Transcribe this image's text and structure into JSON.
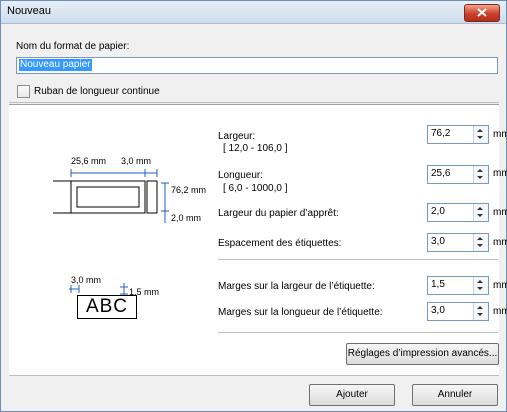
{
  "window": {
    "title": "Nouveau"
  },
  "form": {
    "name_label": "Nom du format de papier:",
    "name_value": "Nouveau papier",
    "continuous_label": "Ruban de longueur continue"
  },
  "diagram": {
    "label_width_dim": "25,6 mm",
    "right_margin_dim": "3,0 mm",
    "height_dim": "76,2 mm",
    "gap_dim": "2,0 mm",
    "margin_top_dim": "3,0 mm",
    "margin_right_dim": "1,5 mm",
    "abc_text": "ABC"
  },
  "fields": {
    "largeur": {
      "label": "Largeur:",
      "range": "[ 12,0 - 106,0 ]",
      "value": "76,2",
      "unit": "mm"
    },
    "longueur": {
      "label": "Longueur:",
      "range": "[ 6,0 - 1000,0 ]",
      "value": "25,6",
      "unit": "mm"
    },
    "largeur_appret": {
      "label": "Largeur du papier d’apprêt:",
      "value": "2,0",
      "unit": "mm"
    },
    "espacement": {
      "label": "Espacement des étiquettes:",
      "value": "3,0",
      "unit": "mm"
    },
    "marges_largeur": {
      "label": "Marges sur la largeur de l’étiquette:",
      "value": "1,5",
      "unit": "mm"
    },
    "marges_longueur": {
      "label": "Marges sur la longueur de l’étiquette:",
      "value": "3,0",
      "unit": "mm"
    }
  },
  "buttons": {
    "advanced": "Réglages d’impression avancés...",
    "add": "Ajouter",
    "cancel": "Annuler"
  }
}
